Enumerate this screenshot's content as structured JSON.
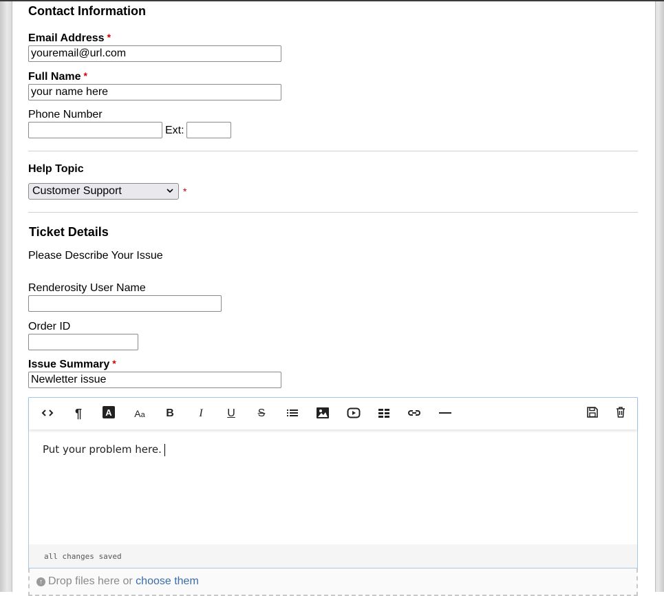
{
  "contact": {
    "title": "Contact Information",
    "email_label": "Email Address",
    "email_value": "youremail@url.com",
    "name_label": "Full Name",
    "name_value": "your name here",
    "phone_label": "Phone Number",
    "phone_value": "",
    "ext_label": "Ext:",
    "ext_value": "",
    "required_mark": "*"
  },
  "help": {
    "title": "Help Topic",
    "selected": "Customer Support",
    "chevron": "⌄"
  },
  "ticket": {
    "title": "Ticket Details",
    "describe_label": "Please Describe Your Issue",
    "username_label": "Renderosity User Name",
    "username_value": "",
    "order_label": "Order ID",
    "order_value": "",
    "summary_label": "Issue Summary",
    "summary_value": "Newletter issue"
  },
  "editor": {
    "toolbar": [
      {
        "name": "code-icon",
        "glyph": "<>"
      },
      {
        "name": "paragraph-icon",
        "glyph": "¶"
      },
      {
        "name": "text-color-icon",
        "glyph": "A"
      },
      {
        "name": "font-size-icon",
        "glyph": "Aa"
      },
      {
        "name": "bold-icon",
        "glyph": "B"
      },
      {
        "name": "italic-icon",
        "glyph": "I"
      },
      {
        "name": "underline-icon",
        "glyph": "U"
      },
      {
        "name": "strikethrough-icon",
        "glyph": "S"
      },
      {
        "name": "list-icon",
        "glyph": "☰"
      },
      {
        "name": "image-icon",
        "glyph": "▣"
      },
      {
        "name": "video-icon",
        "glyph": "▶"
      },
      {
        "name": "table-icon",
        "glyph": "▦"
      },
      {
        "name": "link-icon",
        "glyph": "⊂⊃"
      },
      {
        "name": "horizontal-rule-icon",
        "glyph": "—"
      }
    ],
    "save_icon": "save-icon",
    "delete_icon": "trash-icon",
    "content": "Put your problem here.",
    "status": "all changes saved"
  },
  "attachments": {
    "drop_text": "Drop files here or ",
    "choose_link": "choose them",
    "icon": "upload-icon"
  },
  "colors": {
    "required": "#d00000",
    "link": "#3a6da8",
    "editor_border": "#a9c8e6"
  }
}
